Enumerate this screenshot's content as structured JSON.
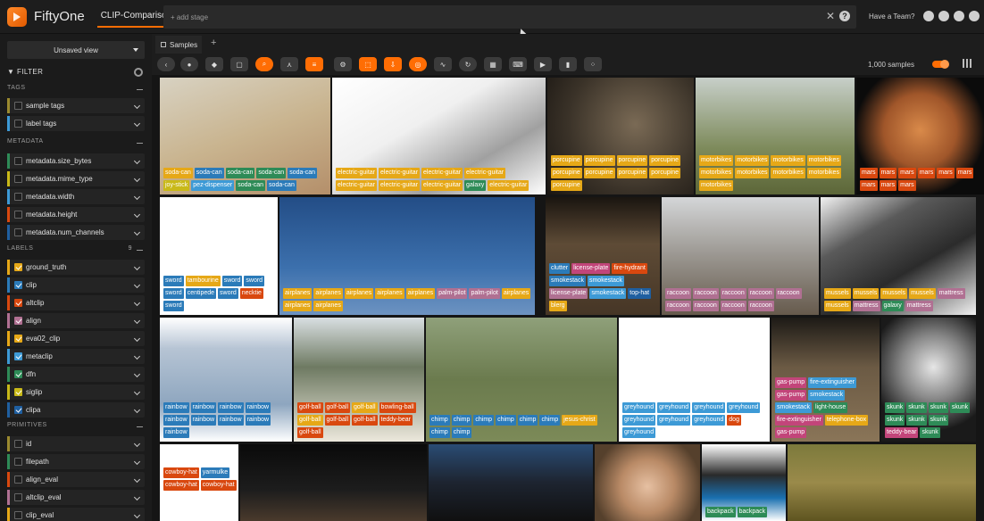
{
  "header": {
    "brand": "FiftyOne",
    "dataset": "CLIP-Comparison",
    "stage_placeholder": "+ add stage",
    "team_link": "Have a Team?"
  },
  "sidebar": {
    "view_select": "Unsaved view",
    "filter_title": "FILTER",
    "sections": {
      "tags": "TAGS",
      "metadata": "METADATA",
      "labels": "LABELS",
      "labels_count": "9",
      "primitives": "PRIMITIVES"
    },
    "tags_fields": [
      "sample tags",
      "label tags"
    ],
    "metadata_fields": [
      "metadata.size_bytes",
      "metadata.mime_type",
      "metadata.width",
      "metadata.height",
      "metadata.num_channels"
    ],
    "label_fields": [
      "ground_truth",
      "clip",
      "altclip",
      "align",
      "eva02_clip",
      "metaclip",
      "dfn",
      "siglip",
      "clipa"
    ],
    "primitive_fields": [
      "id",
      "filepath",
      "align_eval",
      "altclip_eval",
      "clip_eval"
    ],
    "colors": {
      "ground_truth": "#e6a817",
      "clip": "#2b7bb9",
      "altclip": "#d9480f",
      "align": "#b07092",
      "eva02_clip": "#e6a817",
      "metaclip": "#3d9ad6",
      "dfn": "#2e8b57",
      "siglip": "#c9b918",
      "clipa": "#1f5fa0"
    }
  },
  "tabs": {
    "samples": "Samples",
    "add": "+"
  },
  "toolbar": {
    "sample_count": "1,000 samples",
    "accent": "#ff6d04"
  },
  "grid": {
    "samples": [
      {
        "tags": [
          [
            "soda-can",
            "t-gt"
          ],
          [
            "soda-can",
            "t-clip"
          ],
          [
            "soda-can",
            "t-dfn"
          ],
          [
            "soda-can",
            "t-dfn"
          ],
          [
            "soda-can",
            "t-clip"
          ],
          [
            "joy-stick",
            "t-sig"
          ],
          [
            "pez-dispenser",
            "t-meta"
          ],
          [
            "soda-can",
            "t-dfn"
          ],
          [
            "soda-can",
            "t-clip"
          ]
        ]
      },
      {
        "tags": [
          [
            "electric-guitar",
            "t-gt"
          ],
          [
            "electric-guitar",
            "t-eva"
          ],
          [
            "electric-guitar",
            "t-gt"
          ],
          [
            "electric-guitar",
            "t-eva"
          ],
          [
            "electric-guitar",
            "t-gt"
          ],
          [
            "electric-guitar",
            "t-eva"
          ],
          [
            "electric-guitar",
            "t-gt"
          ],
          [
            "galaxy",
            "t-dfn"
          ],
          [
            "electric-guitar",
            "t-gt"
          ]
        ]
      },
      {
        "tags": [
          [
            "porcupine",
            "t-gt"
          ],
          [
            "porcupine",
            "t-eva"
          ],
          [
            "porcupine",
            "t-gt"
          ],
          [
            "porcupine",
            "t-eva"
          ],
          [
            "porcupine",
            "t-gt"
          ],
          [
            "porcupine",
            "t-eva"
          ],
          [
            "porcupine",
            "t-gt"
          ],
          [
            "porcupine",
            "t-eva"
          ],
          [
            "porcupine",
            "t-gt"
          ]
        ]
      },
      {
        "tags": [
          [
            "motorbikes",
            "t-gt"
          ],
          [
            "motorbikes",
            "t-eva"
          ],
          [
            "motorbikes",
            "t-gt"
          ],
          [
            "motorbikes",
            "t-eva"
          ],
          [
            "motorbikes",
            "t-gt"
          ],
          [
            "motorbikes",
            "t-eva"
          ],
          [
            "motorbikes",
            "t-gt"
          ],
          [
            "motorbikes",
            "t-eva"
          ],
          [
            "motorbikes",
            "t-gt"
          ]
        ]
      },
      {
        "tags": [
          [
            "mars",
            "t-alt"
          ],
          [
            "mars",
            "t-alt"
          ],
          [
            "mars",
            "t-alt"
          ],
          [
            "mars",
            "t-alt"
          ],
          [
            "mars",
            "t-alt"
          ],
          [
            "mars",
            "t-alt"
          ],
          [
            "mars",
            "t-alt"
          ],
          [
            "mars",
            "t-alt"
          ],
          [
            "mars",
            "t-alt"
          ]
        ]
      },
      {
        "tags": [
          [
            "sword",
            "t-clip"
          ],
          [
            "tambourine",
            "t-gt"
          ],
          [
            "sword",
            "t-clip"
          ],
          [
            "sword",
            "t-clip"
          ],
          [
            "sword",
            "t-clip"
          ],
          [
            "centipede",
            "t-clip"
          ],
          [
            "sword",
            "t-clip"
          ],
          [
            "necktie",
            "t-alt"
          ],
          [
            "sword",
            "t-clip"
          ]
        ]
      },
      {
        "tags": [
          [
            "airplanes",
            "t-gt"
          ],
          [
            "airplanes",
            "t-eva"
          ],
          [
            "airplanes",
            "t-gt"
          ],
          [
            "airplanes",
            "t-eva"
          ],
          [
            "airplanes",
            "t-gt"
          ],
          [
            "palm-pilot",
            "t-align"
          ],
          [
            "palm-pilot",
            "t-align"
          ],
          [
            "airplanes",
            "t-gt"
          ],
          [
            "airplanes",
            "t-eva"
          ],
          [
            "airplanes",
            "t-gt"
          ]
        ]
      },
      {
        "tags": [
          [
            "clutter",
            "t-clip"
          ],
          [
            "license-plate",
            "t-pink"
          ],
          [
            "fire-hydrant",
            "t-alt"
          ],
          [
            "smokestack",
            "t-clip"
          ],
          [
            "smokestack",
            "t-meta"
          ],
          [
            "license-plate",
            "t-align"
          ],
          [
            "smokestack",
            "t-meta"
          ],
          [
            "top-hat",
            "t-clipa"
          ],
          [
            "blerg",
            "t-gt"
          ]
        ]
      },
      {
        "tags": [
          [
            "raccoon",
            "t-align"
          ],
          [
            "raccoon",
            "t-align"
          ],
          [
            "raccoon",
            "t-align"
          ],
          [
            "raccoon",
            "t-align"
          ],
          [
            "raccoon",
            "t-align"
          ],
          [
            "raccoon",
            "t-align"
          ],
          [
            "raccoon",
            "t-align"
          ],
          [
            "raccoon",
            "t-align"
          ],
          [
            "raccoon",
            "t-align"
          ]
        ]
      },
      {
        "tags": [
          [
            "mussels",
            "t-gt"
          ],
          [
            "mussels",
            "t-eva"
          ],
          [
            "mussels",
            "t-gt"
          ],
          [
            "mussels",
            "t-eva"
          ],
          [
            "mattress",
            "t-align"
          ],
          [
            "mussels",
            "t-gt"
          ],
          [
            "mattress",
            "t-align"
          ],
          [
            "galaxy",
            "t-dfn"
          ],
          [
            "mattress",
            "t-align"
          ]
        ]
      },
      {
        "tags": [
          [
            "rainbow",
            "t-clip"
          ],
          [
            "rainbow",
            "t-clip"
          ],
          [
            "rainbow",
            "t-clip"
          ],
          [
            "rainbow",
            "t-clip"
          ],
          [
            "rainbow",
            "t-clip"
          ],
          [
            "rainbow",
            "t-clip"
          ],
          [
            "rainbow",
            "t-clip"
          ],
          [
            "rainbow",
            "t-clip"
          ],
          [
            "rainbow",
            "t-clip"
          ]
        ]
      },
      {
        "tags": [
          [
            "golf-ball",
            "t-alt"
          ],
          [
            "golf-ball",
            "t-alt"
          ],
          [
            "golf-ball",
            "t-gt"
          ],
          [
            "bowling-ball",
            "t-alt"
          ],
          [
            "golf-ball",
            "t-gt"
          ],
          [
            "golf-ball",
            "t-alt"
          ],
          [
            "golf-ball",
            "t-alt"
          ],
          [
            "teddy-bear",
            "t-alt"
          ],
          [
            "golf-ball",
            "t-alt"
          ]
        ]
      },
      {
        "tags": [
          [
            "chimp",
            "t-clip"
          ],
          [
            "chimp",
            "t-clip"
          ],
          [
            "chimp",
            "t-clip"
          ],
          [
            "chimp",
            "t-clip"
          ],
          [
            "chimp",
            "t-clip"
          ],
          [
            "chimp",
            "t-clip"
          ],
          [
            "jesus-christ",
            "t-gt"
          ],
          [
            "chimp",
            "t-clip"
          ],
          [
            "chimp",
            "t-clip"
          ]
        ]
      },
      {
        "tags": [
          [
            "greyhound",
            "t-meta"
          ],
          [
            "greyhound",
            "t-meta"
          ],
          [
            "greyhound",
            "t-meta"
          ],
          [
            "greyhound",
            "t-meta"
          ],
          [
            "greyhound",
            "t-meta"
          ],
          [
            "greyhound",
            "t-meta"
          ],
          [
            "greyhound",
            "t-meta"
          ],
          [
            "dog",
            "t-alt"
          ],
          [
            "greyhound",
            "t-meta"
          ]
        ]
      },
      {
        "tags": [
          [
            "gas-pump",
            "t-pink"
          ],
          [
            "fire-extinguisher",
            "t-meta"
          ],
          [
            "gas-pump",
            "t-pink"
          ],
          [
            "smokestack",
            "t-meta"
          ],
          [
            "smokestack",
            "t-meta"
          ],
          [
            "light-house",
            "t-dfn"
          ],
          [
            "fire-extinguisher",
            "t-pink"
          ],
          [
            "telephone-box",
            "t-gt"
          ],
          [
            "gas-pump",
            "t-pink"
          ]
        ]
      },
      {
        "tags": [
          [
            "skunk",
            "t-dfn"
          ],
          [
            "skunk",
            "t-dfn"
          ],
          [
            "skunk",
            "t-dfn"
          ],
          [
            "skunk",
            "t-dfn"
          ],
          [
            "skunk",
            "t-dfn"
          ],
          [
            "skunk",
            "t-dfn"
          ],
          [
            "skunk",
            "t-dfn"
          ],
          [
            "teddy-bear",
            "t-pink"
          ],
          [
            "skunk",
            "t-dfn"
          ]
        ]
      },
      {
        "tags": [
          [
            "cowboy-hat",
            "t-alt"
          ],
          [
            "yarmulke",
            "t-clip"
          ],
          [
            "cowboy-hat",
            "t-alt"
          ],
          [
            "cowboy-hat",
            "t-alt"
          ]
        ]
      },
      {
        "tags": []
      },
      {
        "tags": []
      },
      {
        "tags": []
      },
      {
        "tags": [
          [
            "backpack",
            "t-dfn"
          ],
          [
            "backpack",
            "t-dfn"
          ]
        ]
      },
      {
        "tags": []
      }
    ]
  }
}
